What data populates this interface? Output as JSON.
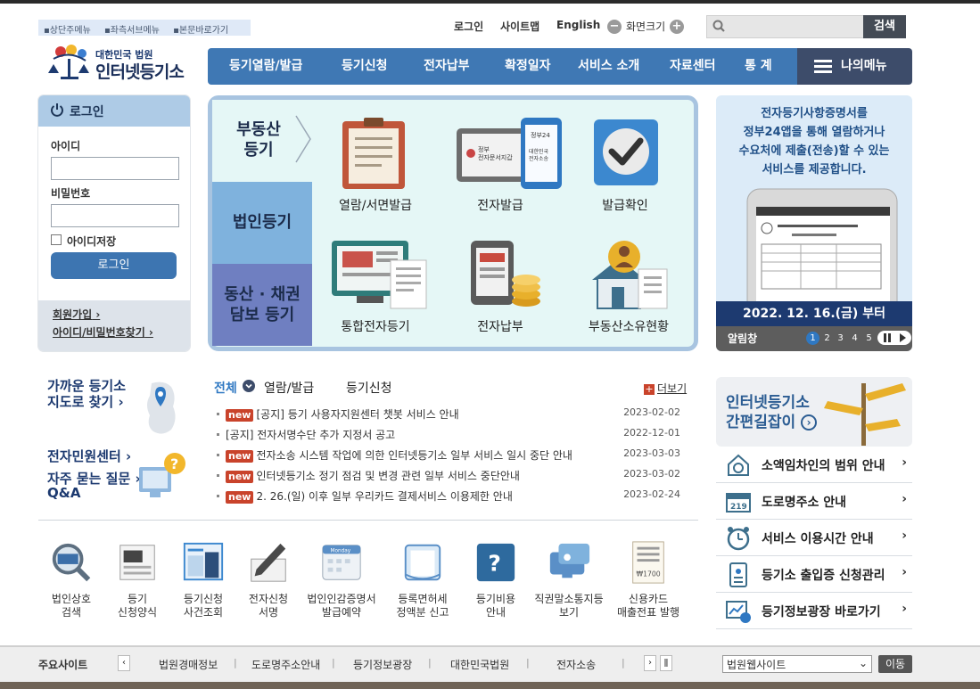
{
  "skip_nav": [
    "상단주메뉴",
    "좌측서브메뉴",
    "본문바로가기"
  ],
  "util": {
    "login": "로그인",
    "sitemap": "사이트맵",
    "english": "English",
    "font_size": "화면크기",
    "minus": "−",
    "plus": "+"
  },
  "search": {
    "button": "검색",
    "placeholder": ""
  },
  "logo": {
    "sub": "대한민국 법원",
    "main": "인터넷등기소"
  },
  "gnb": [
    "등기열람/발급",
    "등기신청",
    "전자납부",
    "확정일자",
    "서비스 소개",
    "자료센터",
    "통 계"
  ],
  "my_menu": "나의메뉴",
  "login_box": {
    "title": "로그인",
    "id_label": "아이디",
    "pw_label": "비밀번호",
    "save_id": "아이디저장",
    "submit": "로그인",
    "join": "회원가입",
    "find": "아이디/비밀번호찾기"
  },
  "main_tabs": {
    "tab1": {
      "line1": "부동산",
      "line2": "등기"
    },
    "tab2": "법인등기",
    "tab3": {
      "line1": "동산 · 채권",
      "line2": "담보 등기"
    }
  },
  "services": [
    "열람/서면발급",
    "전자발급",
    "발급확인",
    "통합전자등기",
    "전자납부",
    "부동산소유현황"
  ],
  "service_icon_text": {
    "gov": "정부\n전자문서지갑",
    "gov24": "정부24",
    "court": "대한민국\n전자소송"
  },
  "banner": {
    "lines": [
      "전자등기사항증명서를",
      "정부24앱을 통해 열람하거나",
      "수요처에 제출(전송)할 수 있는",
      "서비스를 제공합니다."
    ],
    "date": "2022. 12. 16.(금) 부터",
    "alarm_label": "알림창",
    "pages": [
      "1",
      "2",
      "3",
      "4",
      "5"
    ],
    "active_page": "1"
  },
  "near": {
    "line1": "가까운 등기소",
    "line2": "지도로 찾기"
  },
  "civil": {
    "line1": "전자민원센터",
    "line2": "자주 묻는 질문",
    "line3": "Q&A"
  },
  "news": {
    "tabs": [
      "전체",
      "열람/발급",
      "등기신청"
    ],
    "more": "더보기",
    "new_label": "new",
    "items": [
      {
        "new": true,
        "title": "[공지] 등기 사용자지원센터 챗봇 서비스 안내",
        "date": "2023-02-02"
      },
      {
        "new": false,
        "title": "[공지] 전자서명수단 추가 지정서 공고",
        "date": "2022-12-01"
      },
      {
        "new": true,
        "title": "전자소송 시스템 작업에 의한 인터넷등기소 일부 서비스 일시 중단 안내",
        "date": "2023-03-03"
      },
      {
        "new": true,
        "title": "인터넷등기소 정기 점검 및 변경 관련 일부 서비스 중단안내",
        "date": "2023-03-02"
      },
      {
        "new": true,
        "title": "2. 26.(일) 이후 일부 우리카드 결제서비스 이용제한 안내",
        "date": "2023-02-24"
      }
    ]
  },
  "quick_links": [
    {
      "l1": "법인상호",
      "l2": "검색"
    },
    {
      "l1": "등기",
      "l2": "신청양식"
    },
    {
      "l1": "등기신청",
      "l2": "사건조회"
    },
    {
      "l1": "전자신청",
      "l2": "서명"
    },
    {
      "l1": "법인인감증명서",
      "l2": "발급예약"
    },
    {
      "l1": "등록면허세",
      "l2": "정액분 신고"
    },
    {
      "l1": "등기비용",
      "l2": "안내"
    },
    {
      "l1": "직권말소통지등",
      "l2": "보기"
    },
    {
      "l1": "신용카드",
      "l2": "매출전표 발행"
    }
  ],
  "quick_icon_text": {
    "calendar": "Monday",
    "receipt": "₩1700"
  },
  "guide": {
    "line1": "인터넷등기소",
    "line2": "간편길잡이"
  },
  "side_links": [
    "소액임차인의 범위 안내",
    "도로명주소 안내",
    "서비스 이용시간 안내",
    "등기소 출입증 신청관리",
    "등기정보광장 바로가기"
  ],
  "side_icon_text": {
    "road": "219"
  },
  "footer": {
    "label": "주요사이트",
    "sites": [
      "법원경매정보",
      "도로명주소안내",
      "등기정보광장",
      "대한민국법원",
      "전자소송"
    ],
    "select_value": "법원웹사이트",
    "go": "이동"
  },
  "colors": {
    "gnb": "#3f78b4",
    "my_menu": "#3d4c6a",
    "tab_b": "#7fb2dd",
    "tab_c": "#6f7fc1",
    "new_badge": "#c9432b"
  }
}
